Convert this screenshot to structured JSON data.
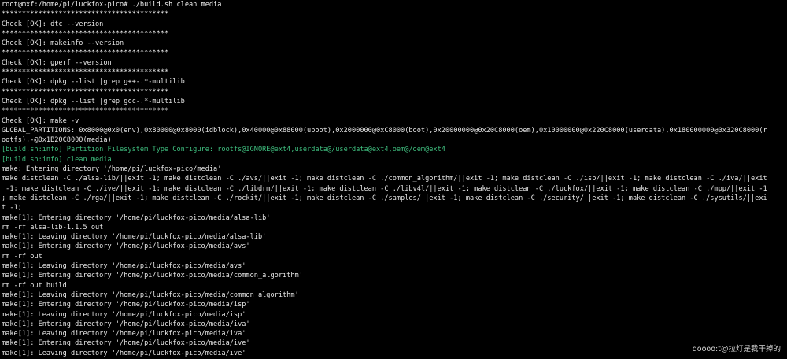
{
  "terminal": {
    "lines": [
      {
        "text": "root@mxf:/home/pi/luckfox-pico# ./build.sh clean media",
        "kind": "prompt"
      },
      {
        "text": "*****************************************",
        "kind": "normal"
      },
      {
        "text": "Check [OK]: dtc --version",
        "kind": "normal"
      },
      {
        "text": "*****************************************",
        "kind": "normal"
      },
      {
        "text": "Check [OK]: makeinfo --version",
        "kind": "normal"
      },
      {
        "text": "*****************************************",
        "kind": "normal"
      },
      {
        "text": "Check [OK]: gperf --version",
        "kind": "normal"
      },
      {
        "text": "*****************************************",
        "kind": "normal"
      },
      {
        "text": "Check [OK]: dpkg --list |grep g++-.*-multilib",
        "kind": "normal"
      },
      {
        "text": "*****************************************",
        "kind": "normal"
      },
      {
        "text": "Check [OK]: dpkg --list |grep gcc-.*-multilib",
        "kind": "normal"
      },
      {
        "text": "*****************************************",
        "kind": "normal"
      },
      {
        "text": "Check [OK]: make -v",
        "kind": "normal"
      },
      {
        "text": "GLOBAL_PARTITIONS: 0x8000@0x0(env),0x80000@0x8000(idblock),0x40000@0x88000(uboot),0x2000000@0xC8000(boot),0x20000000@0x20C8000(oem),0x10000000@0x220C8000(userdata),0x180000000@0x320C8000(r",
        "kind": "normal"
      },
      {
        "text": "ootfs),-@0x1B20C8000(media)",
        "kind": "normal"
      },
      {
        "text": "[build.sh:info] Partition Filesystem Type Configure: rootfs@IGNORE@ext4,userdata@/userdata@ext4,oem@/oem@ext4",
        "kind": "info"
      },
      {
        "text": "[build.sh:info] clean media",
        "kind": "info"
      },
      {
        "text": "make: Entering directory '/home/pi/luckfox-pico/media'",
        "kind": "normal"
      },
      {
        "text": "make distclean -C ./alsa-lib/||exit -1; make distclean -C ./avs/||exit -1; make distclean -C ./common_algorithm/||exit -1; make distclean -C ./isp/||exit -1; make distclean -C ./iva/||exit",
        "kind": "normal"
      },
      {
        "text": " -1; make distclean -C ./ive/||exit -1; make distclean -C ./libdrm/||exit -1; make distclean -C ./libv4l/||exit -1; make distclean -C ./luckfox/||exit -1; make distclean -C ./mpp/||exit -1",
        "kind": "normal"
      },
      {
        "text": "; make distclean -C ./rga/||exit -1; make distclean -C ./rockit/||exit -1; make distclean -C ./samples/||exit -1; make distclean -C ./security/||exit -1; make distclean -C ./sysutils/||exi",
        "kind": "normal"
      },
      {
        "text": "t -1;",
        "kind": "normal"
      },
      {
        "text": "make[1]: Entering directory '/home/pi/luckfox-pico/media/alsa-lib'",
        "kind": "normal"
      },
      {
        "text": "rm -rf alsa-lib-1.1.5 out",
        "kind": "normal"
      },
      {
        "text": "make[1]: Leaving directory '/home/pi/luckfox-pico/media/alsa-lib'",
        "kind": "normal"
      },
      {
        "text": "make[1]: Entering directory '/home/pi/luckfox-pico/media/avs'",
        "kind": "normal"
      },
      {
        "text": "rm -rf out",
        "kind": "normal"
      },
      {
        "text": "make[1]: Leaving directory '/home/pi/luckfox-pico/media/avs'",
        "kind": "normal"
      },
      {
        "text": "make[1]: Entering directory '/home/pi/luckfox-pico/media/common_algorithm'",
        "kind": "normal"
      },
      {
        "text": "rm -rf out build",
        "kind": "normal"
      },
      {
        "text": "make[1]: Leaving directory '/home/pi/luckfox-pico/media/common_algorithm'",
        "kind": "normal"
      },
      {
        "text": "make[1]: Entering directory '/home/pi/luckfox-pico/media/isp'",
        "kind": "normal"
      },
      {
        "text": "make[1]: Leaving directory '/home/pi/luckfox-pico/media/isp'",
        "kind": "normal"
      },
      {
        "text": "make[1]: Entering directory '/home/pi/luckfox-pico/media/iva'",
        "kind": "normal"
      },
      {
        "text": "make[1]: Leaving directory '/home/pi/luckfox-pico/media/iva'",
        "kind": "normal"
      },
      {
        "text": "make[1]: Entering directory '/home/pi/luckfox-pico/media/ive'",
        "kind": "normal"
      },
      {
        "text": "make[1]: Leaving directory '/home/pi/luckfox-pico/media/ive'",
        "kind": "normal"
      }
    ]
  },
  "watermark": "doooo:t@拉灯是我干掉的",
  "colors": {
    "background": "#000000",
    "text": "#e6e6e6",
    "info": "#3fbf7f"
  }
}
